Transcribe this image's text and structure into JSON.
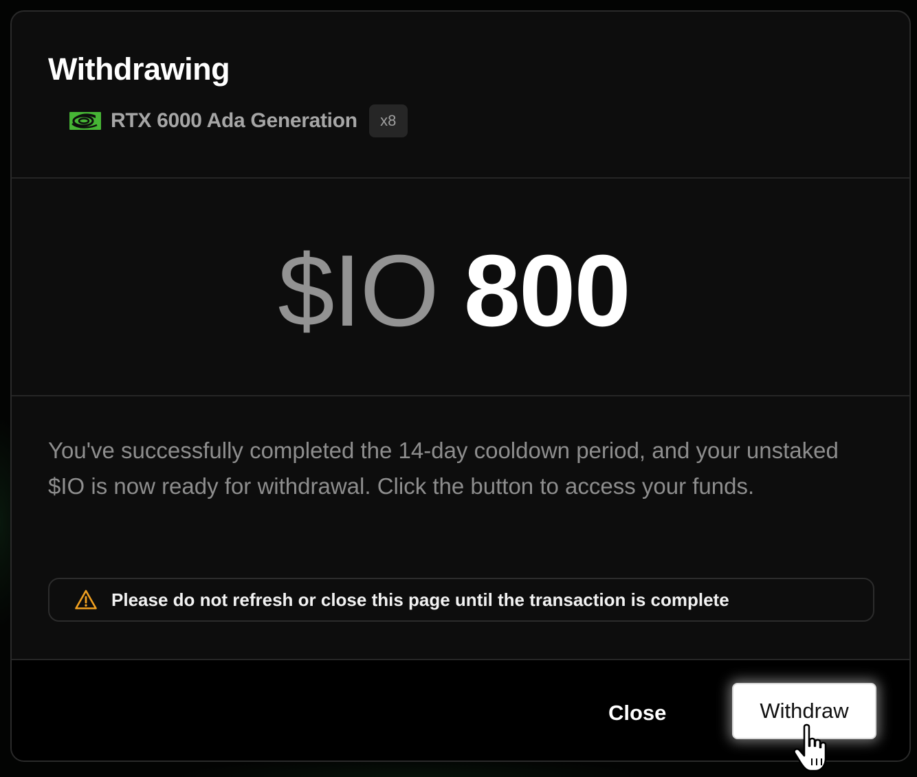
{
  "modal": {
    "title": "Withdrawing",
    "gpu": {
      "icon": "nvidia-logo-icon",
      "name": "RTX 6000 Ada Generation",
      "count": "x8"
    },
    "amount": {
      "currency": "$IO",
      "value": "800"
    },
    "message": "You've successfully completed the 14-day cooldown period, and your unstaked $IO is now ready for withdrawal. Click the button to access your funds.",
    "warning": {
      "icon": "warning-triangle-icon",
      "text": "Please do not refresh or close this page until the transaction is complete"
    },
    "footer": {
      "close_label": "Close",
      "withdraw_label": "Withdraw"
    }
  },
  "colors": {
    "accent_green": "#46b535",
    "warning_amber": "#f0a020",
    "background": "#0d0d0d",
    "primary_button": "#ffffff"
  },
  "cursor": {
    "icon": "hand-pointer-icon"
  }
}
